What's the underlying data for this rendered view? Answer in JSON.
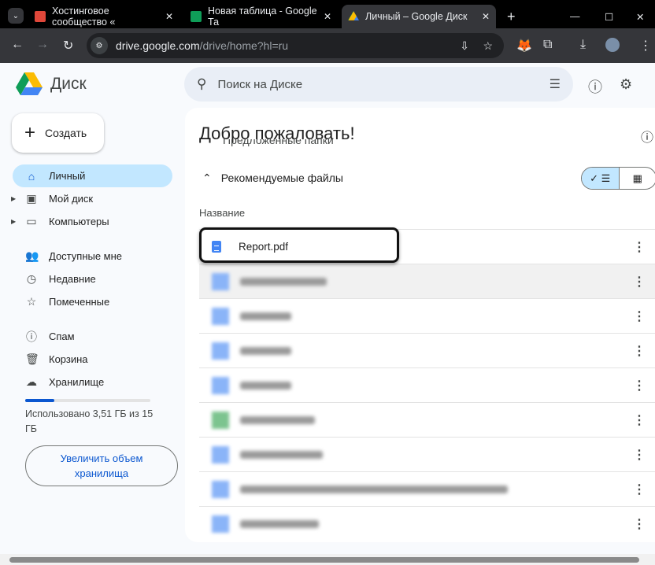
{
  "browser": {
    "tabs": [
      {
        "title": "Хостинговое сообщество «",
        "color": "#e0473a"
      },
      {
        "title": "Новая таблица - Google Та",
        "color": "#0f9d58"
      },
      {
        "title": "Личный – Google Диск",
        "color": "#fbbc04"
      }
    ],
    "url_host": "drive.google.com",
    "url_path": "/drive/home?hl=ru"
  },
  "app": {
    "name": "Диск",
    "search_placeholder": "Поиск на Диске",
    "create_label": "Создать"
  },
  "sidebar": {
    "items": [
      {
        "label": "Личный",
        "icon": "home-icon"
      },
      {
        "label": "Мой диск",
        "icon": "drive-icon"
      },
      {
        "label": "Компьютеры",
        "icon": "computer-icon"
      },
      {
        "label": "Доступные мне",
        "icon": "people-icon"
      },
      {
        "label": "Недавние",
        "icon": "clock-icon"
      },
      {
        "label": "Помеченные",
        "icon": "star-icon"
      },
      {
        "label": "Спам",
        "icon": "spam-icon"
      },
      {
        "label": "Корзина",
        "icon": "trash-icon"
      },
      {
        "label": "Хранилище",
        "icon": "cloud-icon"
      }
    ],
    "storage_text": "Использовано 3,51 ГБ из 15 ГБ",
    "storage_fraction": 0.234,
    "upgrade_label": "Увеличить объем хранилища"
  },
  "main": {
    "welcome": "Добро пожаловать!",
    "suggested_folders": "Предложенные папки",
    "recommended_files": "Рекомендуемые файлы",
    "column_name": "Название",
    "files": [
      {
        "name": "Report.pdf"
      }
    ]
  }
}
